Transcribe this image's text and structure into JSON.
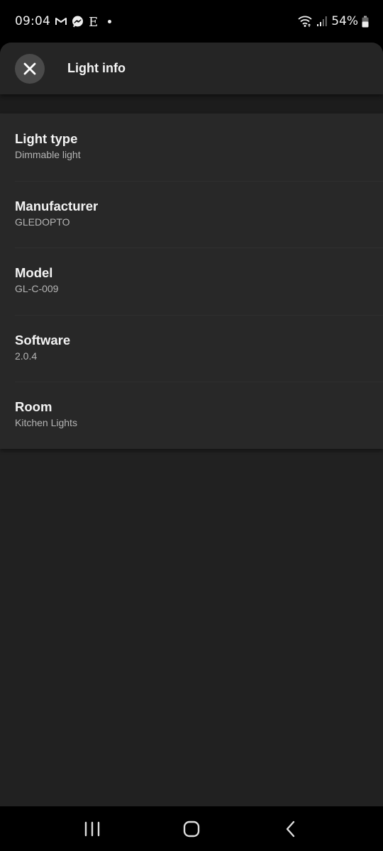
{
  "status_bar": {
    "time": "09:04",
    "notification_icons": [
      "gmail-icon",
      "messenger-icon",
      "e-app-icon",
      "more-dot-icon"
    ],
    "system_icons": [
      "wifi-icon",
      "signal-icon",
      "battery-icon"
    ],
    "battery_percent": "54%"
  },
  "header": {
    "close_icon": "close-icon",
    "title": "Light info"
  },
  "info": {
    "items": [
      {
        "label": "Light type",
        "value": "Dimmable light"
      },
      {
        "label": "Manufacturer",
        "value": "GLEDOPTO"
      },
      {
        "label": "Model",
        "value": "GL-C-009"
      },
      {
        "label": "Software",
        "value": "2.0.4"
      },
      {
        "label": "Room",
        "value": "Kitchen Lights"
      }
    ]
  },
  "nav_bar": {
    "buttons": [
      "recent-apps-icon",
      "home-icon",
      "back-icon"
    ]
  }
}
